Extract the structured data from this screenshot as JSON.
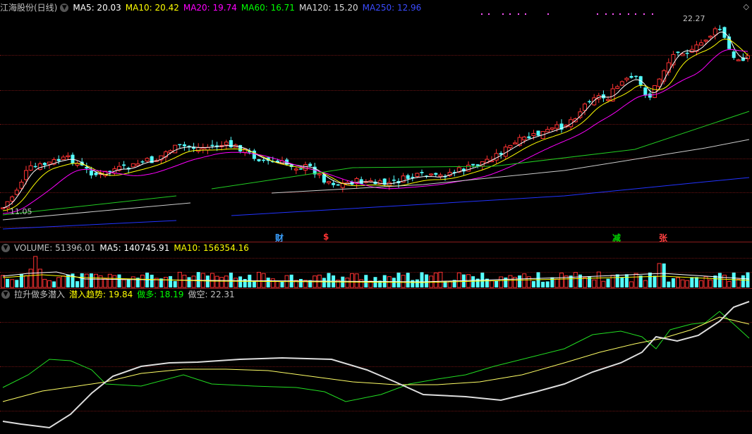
{
  "main_header": {
    "title": "江海股份(日线)",
    "ma": [
      {
        "label": "MA5: 20.03",
        "color": "#ffffff"
      },
      {
        "label": "MA10: 20.42",
        "color": "#ffff00"
      },
      {
        "label": "MA20: 19.74",
        "color": "#ff00ff"
      },
      {
        "label": "MA60: 16.71",
        "color": "#00ff00"
      },
      {
        "label": "MA120: 15.20",
        "color": "#dcdcdc"
      },
      {
        "label": "MA250: 12.96",
        "color": "#3b4cff"
      }
    ]
  },
  "price_labels": {
    "high": "22.27",
    "low": "11.05"
  },
  "events": [
    {
      "label": "财",
      "color": "#3aa0ff"
    },
    {
      "label": "$",
      "color": "#ff3333"
    },
    {
      "label": "减",
      "color": "#00d000"
    },
    {
      "label": "张",
      "color": "#ff4040"
    }
  ],
  "volume_header": {
    "items": [
      {
        "label": "VOLUME: 51396.01",
        "color": "#c0c0c0"
      },
      {
        "label": "MA5: 140745.91",
        "color": "#ffffff"
      },
      {
        "label": "MA10: 156354.16",
        "color": "#ffff00"
      }
    ]
  },
  "indicator_header": {
    "name": "拉升做多潜入",
    "items": [
      {
        "label": "潜入趋势: 19.84",
        "color": "#ffff00"
      },
      {
        "label": "做多: 18.19",
        "color": "#00ff00"
      },
      {
        "label": "做空: 22.31",
        "color": "#c0c0c0"
      }
    ]
  },
  "colors": {
    "up": "#ff3232",
    "down": "#54ffff",
    "grid": "#8a1c1c",
    "bg": "#000000"
  }
}
